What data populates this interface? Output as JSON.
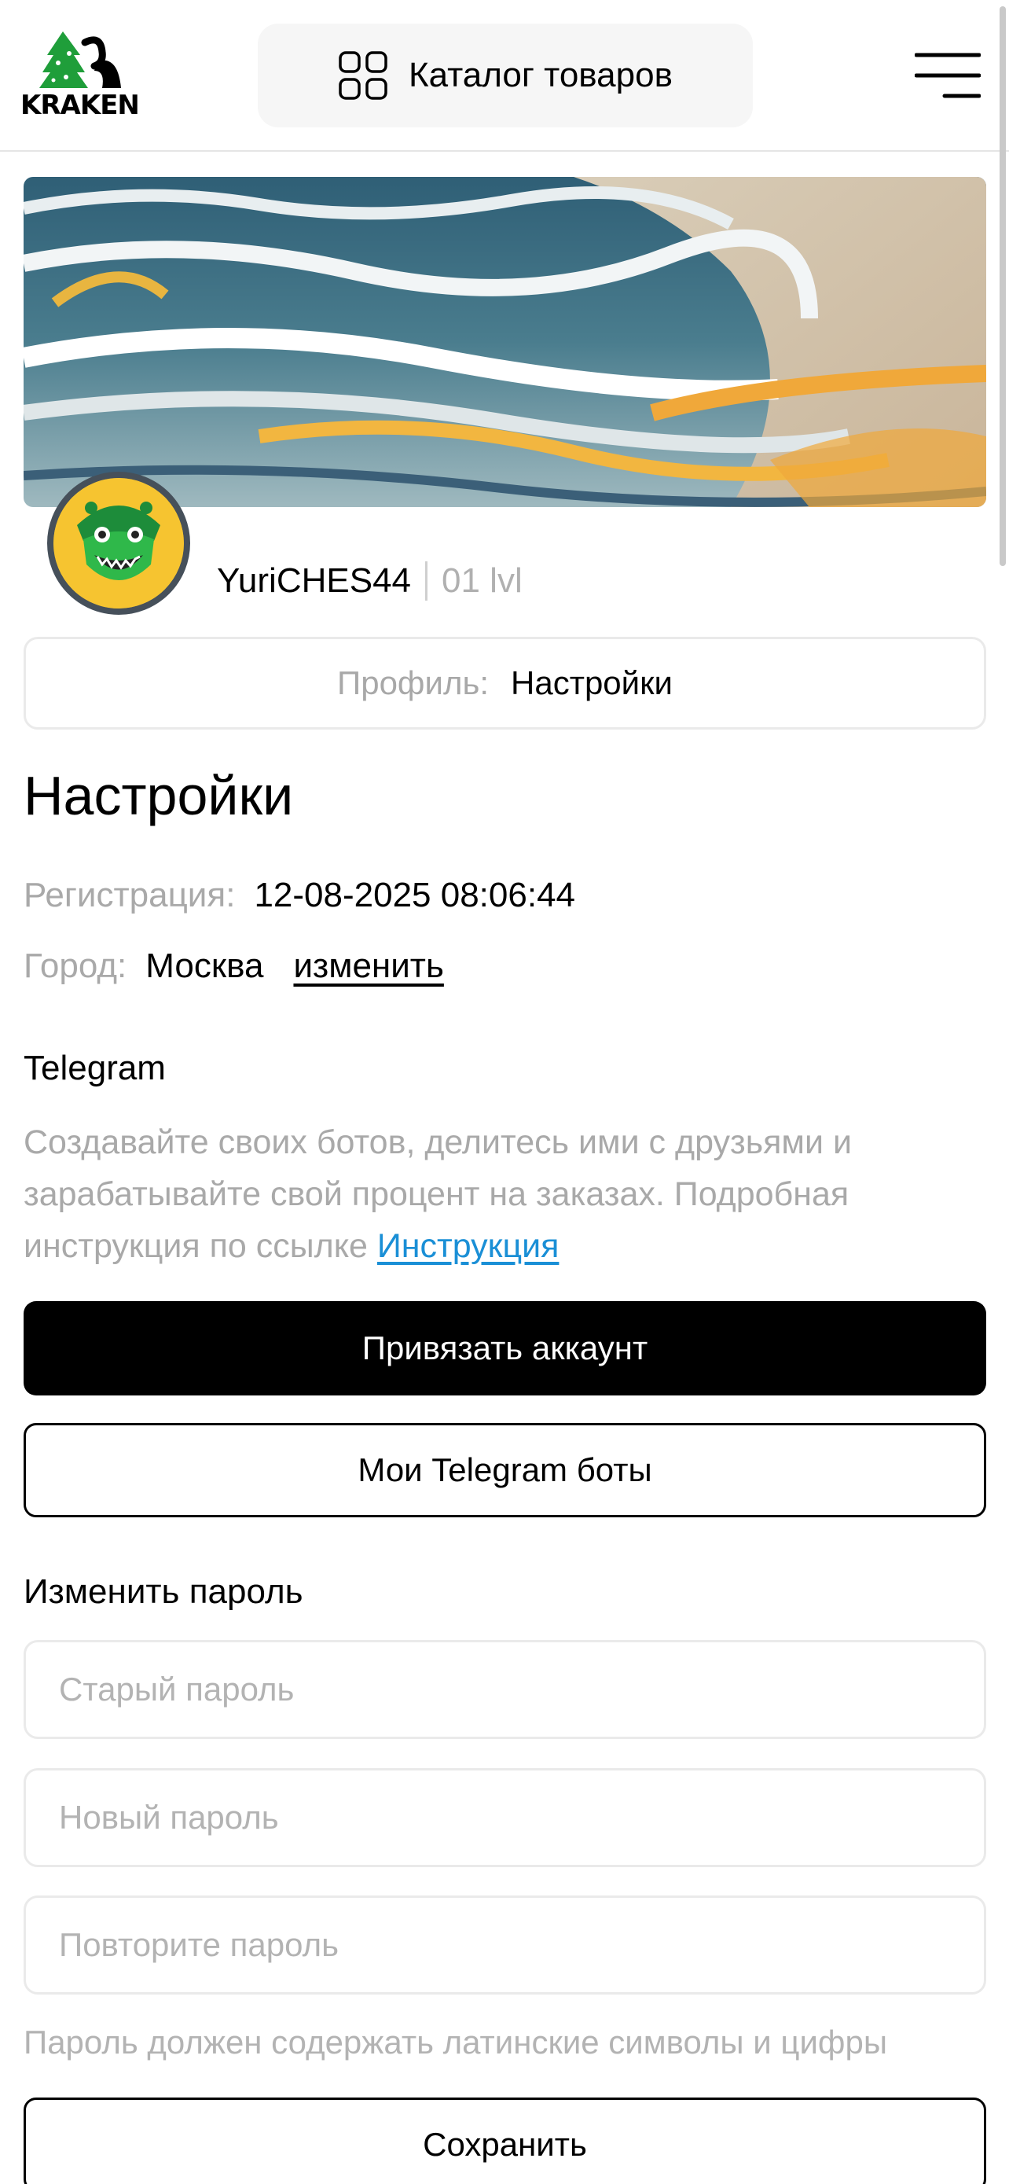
{
  "header": {
    "logo_text": "KRAKEN",
    "catalog_label": "Каталог товаров"
  },
  "profile": {
    "username": "YuriCHES44",
    "level": "01 lvl"
  },
  "breadcrumb": {
    "prefix": "Профиль:",
    "current": "Настройки"
  },
  "page_title": "Настройки",
  "registration": {
    "label": "Регистрация:",
    "value": "12-08-2025 08:06:44"
  },
  "city": {
    "label": "Город:",
    "value": "Москва",
    "change_label": "изменить"
  },
  "telegram": {
    "title": "Telegram",
    "description": "Создавайте своих ботов, делитесь ими с друзьями и зарабатывайте свой процент на заказах. Подробная инструкция по ссылке ",
    "link_label": "Инструкция",
    "link_account_button": "Привязать аккаунт",
    "my_bots_button": "Мои Telegram боты"
  },
  "password": {
    "title": "Изменить пароль",
    "old_placeholder": "Старый пароль",
    "new_placeholder": "Новый пароль",
    "repeat_placeholder": "Повторите пароль",
    "hint": "Пароль должен содержать латинские символы и цифры",
    "save_button": "Сохранить"
  },
  "colors": {
    "link": "#1a8fd6",
    "primary_button": "#000000",
    "muted_text": "#a9a9a9"
  },
  "icons": [
    "kraken-logo-icon",
    "grid-icon",
    "menu-icon",
    "avatar-crocodile-icon"
  ]
}
